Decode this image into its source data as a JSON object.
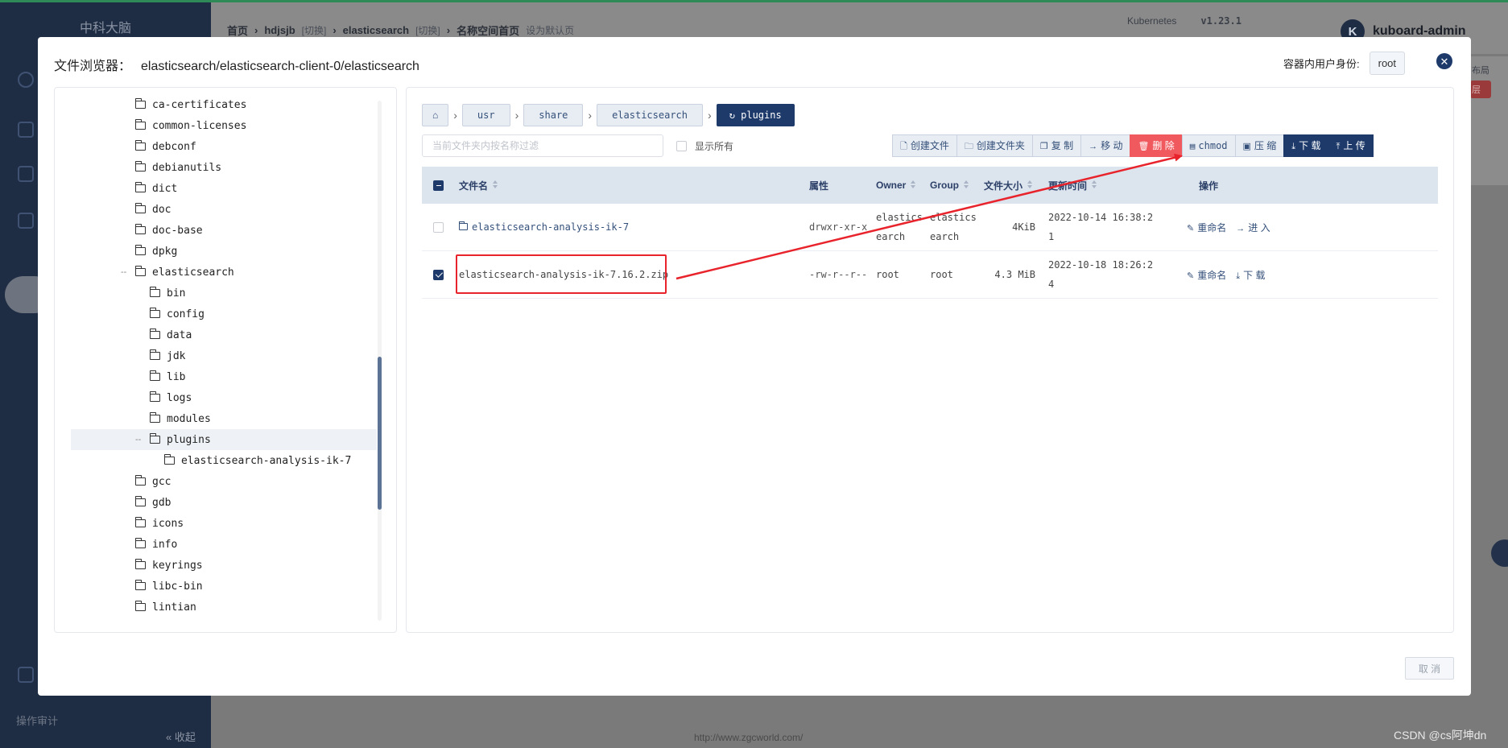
{
  "background": {
    "brand": "中科大脑",
    "breadcrumb": [
      "首页",
      "hdjsjb",
      "[切换]",
      "elasticsearch",
      "[切换]",
      "名称空间首页",
      "设为默认页"
    ],
    "k8s_label": "Kubernetes",
    "k8s_version": "v1.23.1",
    "user": "kuboard-admin",
    "user_initial": "K",
    "layout_label": "布局",
    "red_badge": "层",
    "audit_label": "操作审计",
    "collapse_label": "« 收起",
    "url_text": "http://www.zgcworld.com/",
    "watermark": "CSDN @cs阿坤dn"
  },
  "modal": {
    "title_label": "文件浏览器：",
    "title_path": "elasticsearch/elasticsearch-client-0/elasticsearch",
    "identity_label": "容器内用户身份:",
    "identity_value": "root",
    "close_icon": "close-icon",
    "cancel_label": "取 消"
  },
  "tree": {
    "items": [
      {
        "label": "ca-certificates"
      },
      {
        "label": "common-licenses"
      },
      {
        "label": "debconf"
      },
      {
        "label": "debianutils"
      },
      {
        "label": "dict"
      },
      {
        "label": "doc"
      },
      {
        "label": "doc-base"
      },
      {
        "label": "dpkg"
      },
      {
        "label": "elasticsearch"
      },
      {
        "label": "bin"
      },
      {
        "label": "config"
      },
      {
        "label": "data"
      },
      {
        "label": "jdk"
      },
      {
        "label": "lib"
      },
      {
        "label": "logs"
      },
      {
        "label": "modules"
      },
      {
        "label": "plugins"
      },
      {
        "label": "elasticsearch-analysis-ik-7"
      },
      {
        "label": "gcc"
      },
      {
        "label": "gdb"
      },
      {
        "label": "icons"
      },
      {
        "label": "info"
      },
      {
        "label": "keyrings"
      },
      {
        "label": "libc-bin"
      },
      {
        "label": "lintian"
      }
    ]
  },
  "crumbs": {
    "home_icon": "home-icon",
    "items": [
      "usr",
      "share",
      "elasticsearch"
    ],
    "current": "plugins",
    "current_icon": "refresh-icon"
  },
  "filter": {
    "placeholder": "当前文件夹内按名称过滤",
    "value": ""
  },
  "show_all_label": "显示所有",
  "toolbar": {
    "create_file": "创建文件",
    "create_folder": "创建文件夹",
    "copy": "复 制",
    "move": "移 动",
    "delete": "删 除",
    "chmod": "chmod",
    "compress": "压 缩",
    "download": "下 载",
    "upload": "上 传"
  },
  "table": {
    "headers": {
      "name": "文件名",
      "attr": "属性",
      "owner": "Owner",
      "group": "Group",
      "size": "文件大小",
      "mtime": "更新时间",
      "ops": "操作"
    },
    "rows": [
      {
        "name": "elasticsearch-analysis-ik-7",
        "attr": "drwxr-xr-x",
        "owner_1": "elastics",
        "owner_2": "earch",
        "group_1": "elastics",
        "group_2": "earch",
        "size": "4KiB",
        "mtime_1": "2022-10-14 16:38:2",
        "mtime_2": "1",
        "op1": "重命名",
        "op2": "进 入",
        "checked": false
      },
      {
        "name": "elasticsearch-analysis-ik-7.16.2.zip",
        "attr": "-rw-r--r--",
        "owner": "root",
        "group": "root",
        "size": "4.3 MiB",
        "mtime_1": "2022-10-18 18:26:2",
        "mtime_2": "4",
        "op1": "重命名",
        "op2": "下 载",
        "checked": true
      }
    ]
  },
  "colors": {
    "primary": "#1d3a6b",
    "danger": "#f05a5f",
    "annotation": "#e8232b"
  }
}
